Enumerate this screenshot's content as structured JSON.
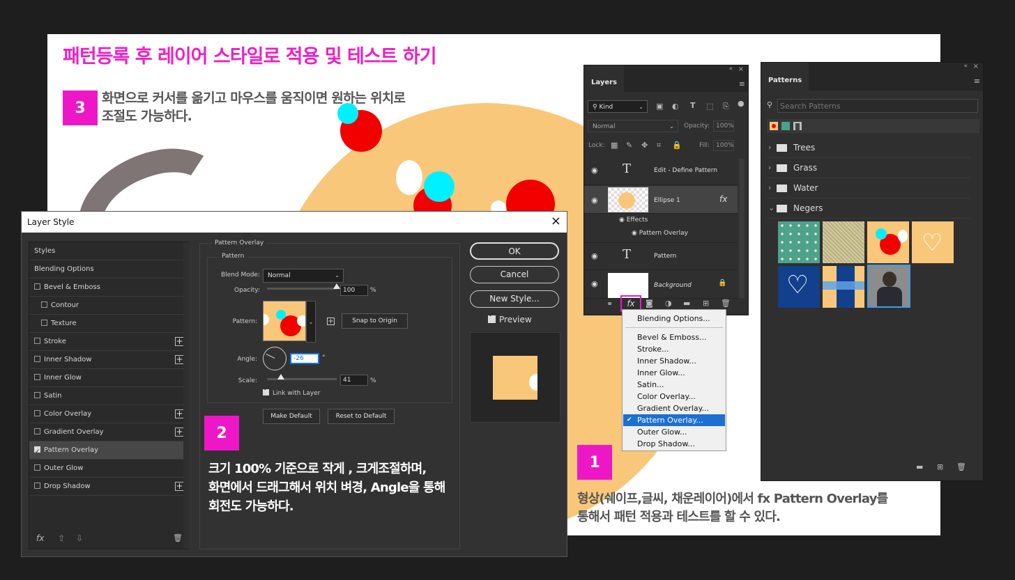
{
  "slide": {
    "title": "패턴등록 후 레이어 스타일로 적용 및 테스트 하기",
    "step3": {
      "num": "3",
      "line1": "화면으로 커서를 옮기고 마우스를 움직이면 원하는 위치로",
      "line2": "조절도 가능하다."
    },
    "step2": {
      "num": "2",
      "line1": "크기 100% 기준으로 작게 , 크게조절하며,",
      "line2": "화면에서 드래그해서 위치 벼경, Angle을 통해",
      "line3": "회전도 가능하다."
    },
    "step1": {
      "num": "1",
      "line1": "형상(쉐이프,글씨, 채운레이어)에서 fx Pattern Overlay를",
      "line2": "통해서 패턴 적용과 테스트를 할 수 있다."
    },
    "colors": {
      "accent": "#ee17c8",
      "cookie": "#f9c779",
      "red": "#f20000",
      "cyan": "#00f0ff"
    }
  },
  "dialog": {
    "title": "Layer Style",
    "close_icon": "×",
    "styles": [
      {
        "label": "Styles",
        "checkbox": false,
        "plus": false,
        "indent": false,
        "checked": false
      },
      {
        "label": "Blending Options",
        "checkbox": false,
        "plus": false,
        "indent": false,
        "checked": false
      },
      {
        "label": "Bevel & Emboss",
        "checkbox": true,
        "plus": false,
        "indent": false,
        "checked": false
      },
      {
        "label": "Contour",
        "checkbox": true,
        "plus": false,
        "indent": true,
        "checked": false
      },
      {
        "label": "Texture",
        "checkbox": true,
        "plus": false,
        "indent": true,
        "checked": false
      },
      {
        "label": "Stroke",
        "checkbox": true,
        "plus": true,
        "indent": false,
        "checked": false
      },
      {
        "label": "Inner Shadow",
        "checkbox": true,
        "plus": true,
        "indent": false,
        "checked": false
      },
      {
        "label": "Inner Glow",
        "checkbox": true,
        "plus": false,
        "indent": false,
        "checked": false
      },
      {
        "label": "Satin",
        "checkbox": true,
        "plus": false,
        "indent": false,
        "checked": false
      },
      {
        "label": "Color Overlay",
        "checkbox": true,
        "plus": true,
        "indent": false,
        "checked": false
      },
      {
        "label": "Gradient Overlay",
        "checkbox": true,
        "plus": true,
        "indent": false,
        "checked": false
      },
      {
        "label": "Pattern Overlay",
        "checkbox": true,
        "plus": false,
        "indent": false,
        "checked": true,
        "selected": true
      },
      {
        "label": "Outer Glow",
        "checkbox": true,
        "plus": false,
        "indent": false,
        "checked": false
      },
      {
        "label": "Drop Shadow",
        "checkbox": true,
        "plus": true,
        "indent": false,
        "checked": false
      }
    ],
    "footer_icons": {
      "fx": "fx",
      "up": "⇧",
      "down": "⇩",
      "trash": "🗑"
    },
    "section_title": "Pattern Overlay",
    "group_title": "Pattern",
    "blend_mode_label": "Blend Mode:",
    "blend_mode_value": "Normal",
    "opacity_label": "Opacity:",
    "opacity_value": "100",
    "opacity_fraction": 1.0,
    "percent": "%",
    "pattern_label": "Pattern:",
    "snap_label": "Snap to Origin",
    "angle_label": "Angle:",
    "angle_value": "-26",
    "degree": "°",
    "scale_label": "Scale:",
    "scale_value": "41",
    "scale_fraction": 0.2,
    "link_label": "Link with Layer",
    "make_default": "Make Default",
    "reset_default": "Reset to Default",
    "ok": "OK",
    "cancel": "Cancel",
    "new_style": "New Style...",
    "preview_label": "Preview"
  },
  "layers": {
    "tab": "Layers",
    "kind": "Kind",
    "blend": "Normal",
    "opacity_label": "Opacity:",
    "opacity_value": "100%",
    "lock_label": "Lock:",
    "fill_label": "Fill:",
    "fill_value": "100%",
    "rows": {
      "edit": "Edit - Define Pattern",
      "ellipse": "Ellipse 1",
      "effects": "Effects",
      "pattern_overlay": "Pattern Overlay",
      "pattern": "Pattern",
      "background": "Background"
    },
    "fx_badge": "fx"
  },
  "menu": {
    "items": [
      "Blending Options...",
      "Bevel & Emboss...",
      "Stroke...",
      "Inner Shadow...",
      "Inner Glow...",
      "Satin...",
      "Color Overlay...",
      "Gradient Overlay...",
      "Pattern Overlay...",
      "Outer Glow...",
      "Drop Shadow..."
    ],
    "checked": "✔"
  },
  "patterns": {
    "tab": "Patterns",
    "search_placeholder": "Search Patterns",
    "folders": [
      "Trees",
      "Grass",
      "Water",
      "Negers"
    ]
  }
}
